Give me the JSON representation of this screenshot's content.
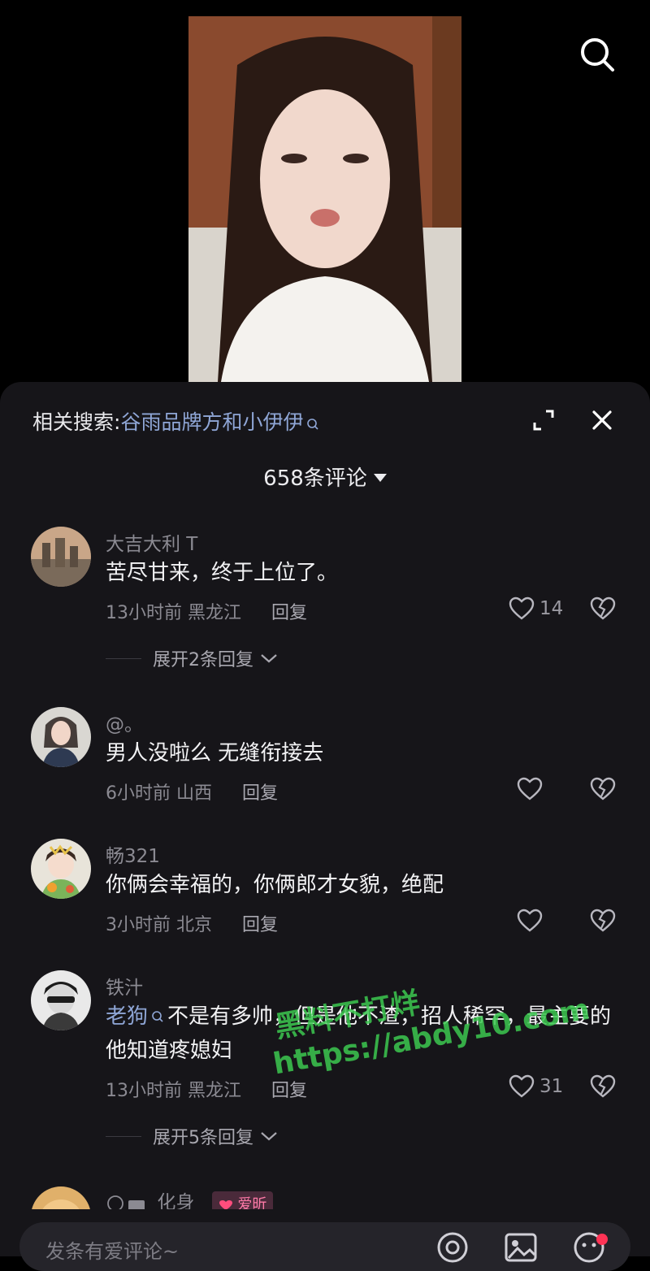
{
  "sheet": {
    "related_prefix": "相关搜索:",
    "related_term": "谷雨品牌方和小伊伊",
    "comment_count": "658条评论"
  },
  "comments": [
    {
      "author": "大吉大利 T",
      "text": "苦尽甘来，终于上位了。",
      "time": "13小时前",
      "location": "黑龙江",
      "reply": "回复",
      "likes": "14",
      "expand": "展开2条回复"
    },
    {
      "author": "@。",
      "text": "男人没啦么 无缝衔接去",
      "time": "6小时前",
      "location": "山西",
      "reply": "回复",
      "likes": ""
    },
    {
      "author": "畅321",
      "text": "你俩会幸福的，你俩郎才女貌，绝配",
      "time": "3小时前",
      "location": "北京",
      "reply": "回复",
      "likes": ""
    },
    {
      "author": "铁汁",
      "mention": "老狗",
      "text": "不是有多帅，但是他不渣，招人稀罕，最主要的他知道疼媳妇",
      "time": "13小时前",
      "location": "黑龙江",
      "reply": "回复",
      "likes": "31",
      "expand": "展开5条回复"
    },
    {
      "author": "化身",
      "badge": "爱昕"
    }
  ],
  "watermark": {
    "line1": "黑料不打烊",
    "line2": "https://abdy10.com"
  },
  "input": {
    "placeholder": "发条有爱评论~"
  },
  "colors": {
    "sheet_bg": "#161519",
    "accent_link": "#8fa6d6",
    "notification_dot": "#ff3355"
  }
}
